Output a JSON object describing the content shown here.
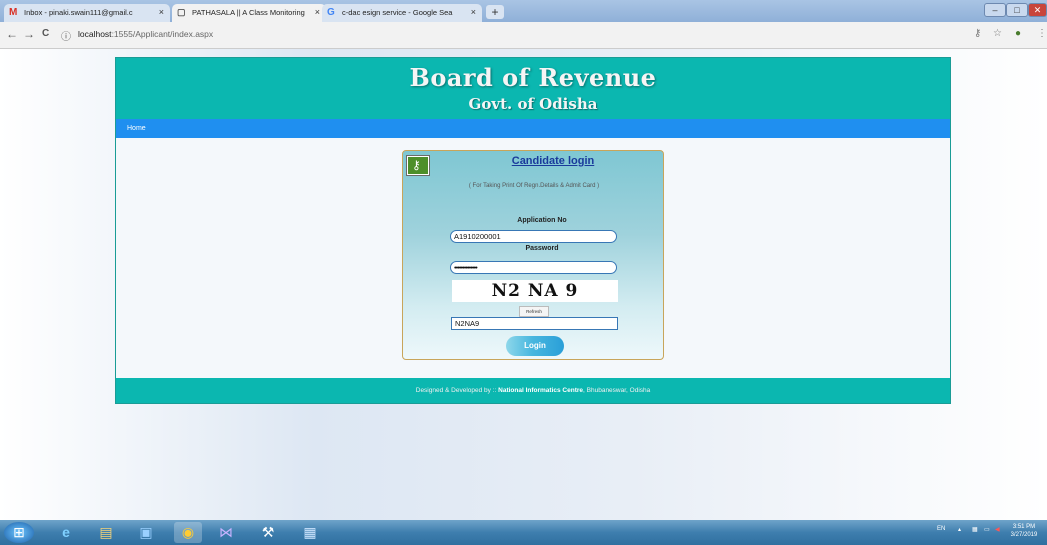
{
  "browser": {
    "tabs": [
      {
        "icon": "M",
        "title": "Inbox - pinaki.swain111@gmail.c",
        "close": "×"
      },
      {
        "icon": "▢",
        "title": "PATHASALA || A Class Monitoring",
        "close": "×"
      },
      {
        "icon": "G",
        "title": "c-dac esign service - Google Sea",
        "close": "×"
      }
    ],
    "new_tab": "+",
    "url_host": "localhost",
    "url_path": ":1555/Applicant/index.aspx",
    "back": "←",
    "forward": "→",
    "reload": "C",
    "info": "ⓘ",
    "win_min": "–",
    "win_max": "□",
    "win_close": "✕"
  },
  "header": {
    "title": "Board of Revenue",
    "subtitle": "Govt. of Odisha"
  },
  "menu": {
    "home": "Home"
  },
  "login": {
    "title": "Candidate login",
    "note": "( For Taking Print Of Regn.Details &  Admit Card )",
    "app_no_label": "Application No",
    "app_no_value": "A1910200001",
    "password_label": "Password",
    "password_value": "••••••••••••••",
    "captcha_text": "N2 NA 9",
    "refresh_label": "Refresh",
    "captcha_value": "N2NA9",
    "login_button": "Login"
  },
  "footer": {
    "prefix": "Designed & Developed by :: ",
    "org": "National Informatics Centre",
    "suffix": ", Bhubaneswar, Odisha"
  },
  "taskbar": {
    "lang": "EN",
    "time": "3:51 PM",
    "date": "3/27/2019"
  }
}
